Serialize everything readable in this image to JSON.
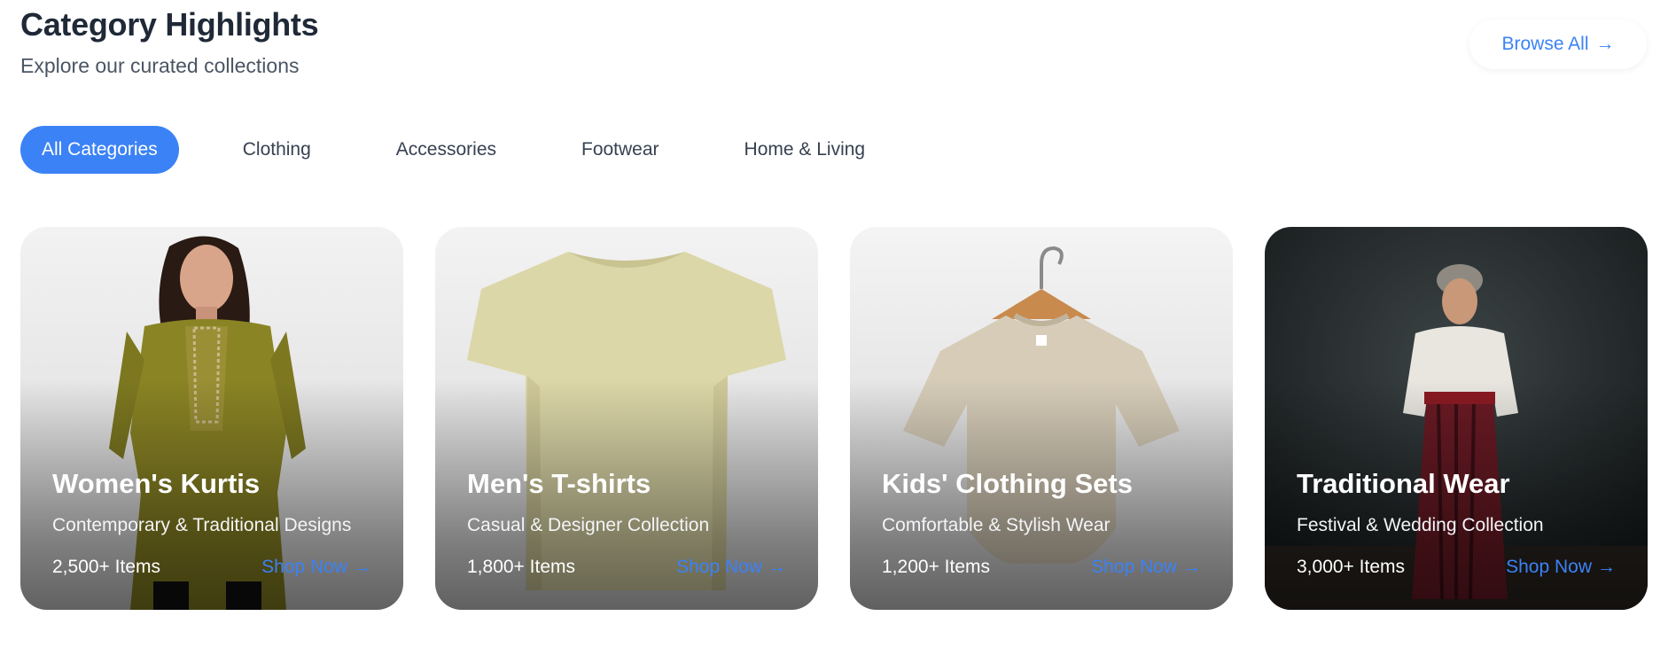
{
  "header": {
    "title": "Category Highlights",
    "subtitle": "Explore our curated collections",
    "browse_label": "Browse All",
    "arrow": "→"
  },
  "tabs": [
    {
      "label": "All Categories",
      "active": true
    },
    {
      "label": "Clothing",
      "active": false
    },
    {
      "label": "Accessories",
      "active": false
    },
    {
      "label": "Footwear",
      "active": false
    },
    {
      "label": "Home & Living",
      "active": false
    }
  ],
  "cards": [
    {
      "title": "Women's Kurtis",
      "description": "Contemporary & Traditional Designs",
      "count": "2,500+ Items",
      "link": "Shop Now",
      "arrow": "→"
    },
    {
      "title": "Men's T-shirts",
      "description": "Casual & Designer Collection",
      "count": "1,800+ Items",
      "link": "Shop Now",
      "arrow": "→"
    },
    {
      "title": "Kids' Clothing Sets",
      "description": "Comfortable & Stylish Wear",
      "count": "1,200+ Items",
      "link": "Shop Now",
      "arrow": "→"
    },
    {
      "title": "Traditional Wear",
      "description": "Festival & Wedding Collection",
      "count": "3,000+ Items",
      "link": "Shop Now",
      "arrow": "→"
    }
  ],
  "colors": {
    "accent": "#3b82f6",
    "heading": "#1f2937",
    "muted": "#4b5563"
  }
}
